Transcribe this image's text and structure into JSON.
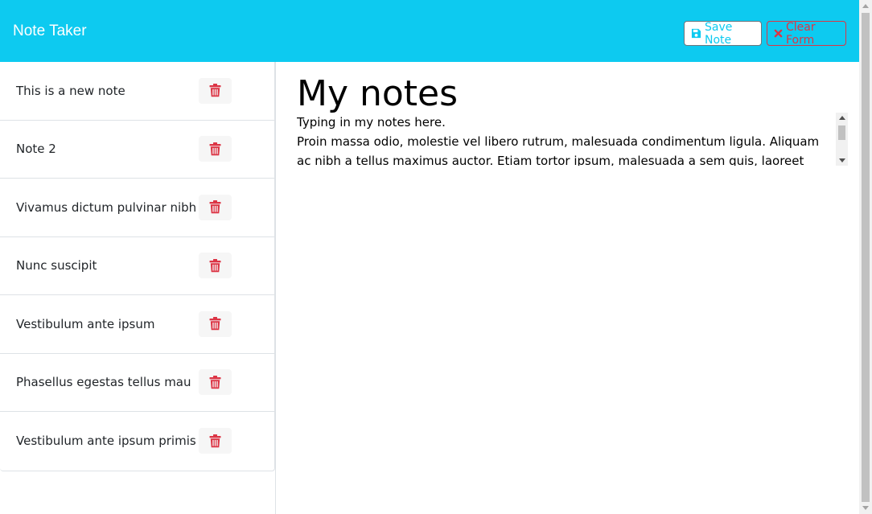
{
  "navbar": {
    "brand": "Note Taker",
    "save_label": "Save Note",
    "clear_label": "Clear Form",
    "save_icon": "floppy-disk-icon",
    "clear_icon": "x-icon",
    "accent_color": "#0dcaf0",
    "danger_color": "#dc3545"
  },
  "sidebar": {
    "notes": [
      {
        "title": "This is a new note"
      },
      {
        "title": "Note 2"
      },
      {
        "title": "Vivamus dictum pulvinar nibh"
      },
      {
        "title": "Nunc suscipit"
      },
      {
        "title": "Vestibulum ante ipsum"
      },
      {
        "title": "Phasellus egestas tellus mau"
      },
      {
        "title": "Vestibulum ante ipsum primis"
      }
    ],
    "delete_icon": "trash-icon"
  },
  "editor": {
    "title": "My notes",
    "text": "Typing in my notes here.\nProin massa odio, molestie vel libero rutrum, malesuada condimentum ligula. Aliquam ac nibh a tellus maximus auctor. Etiam tortor ipsum, malesuada a sem quis, laoreet luctus lectus. Duis"
  }
}
